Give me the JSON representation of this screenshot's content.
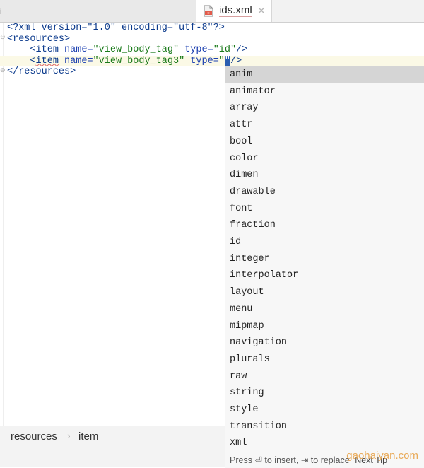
{
  "tabbar": {
    "left_mark": "i",
    "tab": {
      "label": "ids.xml",
      "close_glyph": "✕",
      "file_icon": "xml-file-icon"
    }
  },
  "editor": {
    "lines": [
      {
        "kind": "pi",
        "text": "<?xml version=\"1.0\" encoding=\"utf-8\"?>"
      },
      {
        "kind": "open",
        "tag": "resources"
      },
      {
        "kind": "item",
        "indent": "    ",
        "tag": "item",
        "name_attr": "name",
        "name_val": "\"view_body_tag\"",
        "type_attr": "type",
        "type_val": "\"id\"",
        "close": "/>"
      },
      {
        "kind": "item-current",
        "indent": "    ",
        "tag": "item",
        "name_attr": "name",
        "name_val": "\"view_body_tag3\"",
        "type_attr": "type",
        "type_val_open": "\"",
        "type_val_sel": "\"",
        "close": "/>"
      },
      {
        "kind": "close",
        "tag": "resources"
      }
    ]
  },
  "completion": {
    "items": [
      "anim",
      "animator",
      "array",
      "attr",
      "bool",
      "color",
      "dimen",
      "drawable",
      "font",
      "fraction",
      "id",
      "integer",
      "interpolator",
      "layout",
      "menu",
      "mipmap",
      "navigation",
      "plurals",
      "raw",
      "string",
      "style",
      "transition",
      "xml"
    ],
    "selected_index": 0,
    "footer": {
      "press": "Press",
      "enter_symbol": "⏎",
      "to_insert": "to insert,",
      "tab_symbol": "⇥",
      "to_replace": "to replace",
      "next_tip": "Next Tip"
    }
  },
  "breadcrumb": {
    "items": [
      "resources",
      "item"
    ],
    "separator": "›"
  },
  "watermark": "gaohaiyan.com"
}
